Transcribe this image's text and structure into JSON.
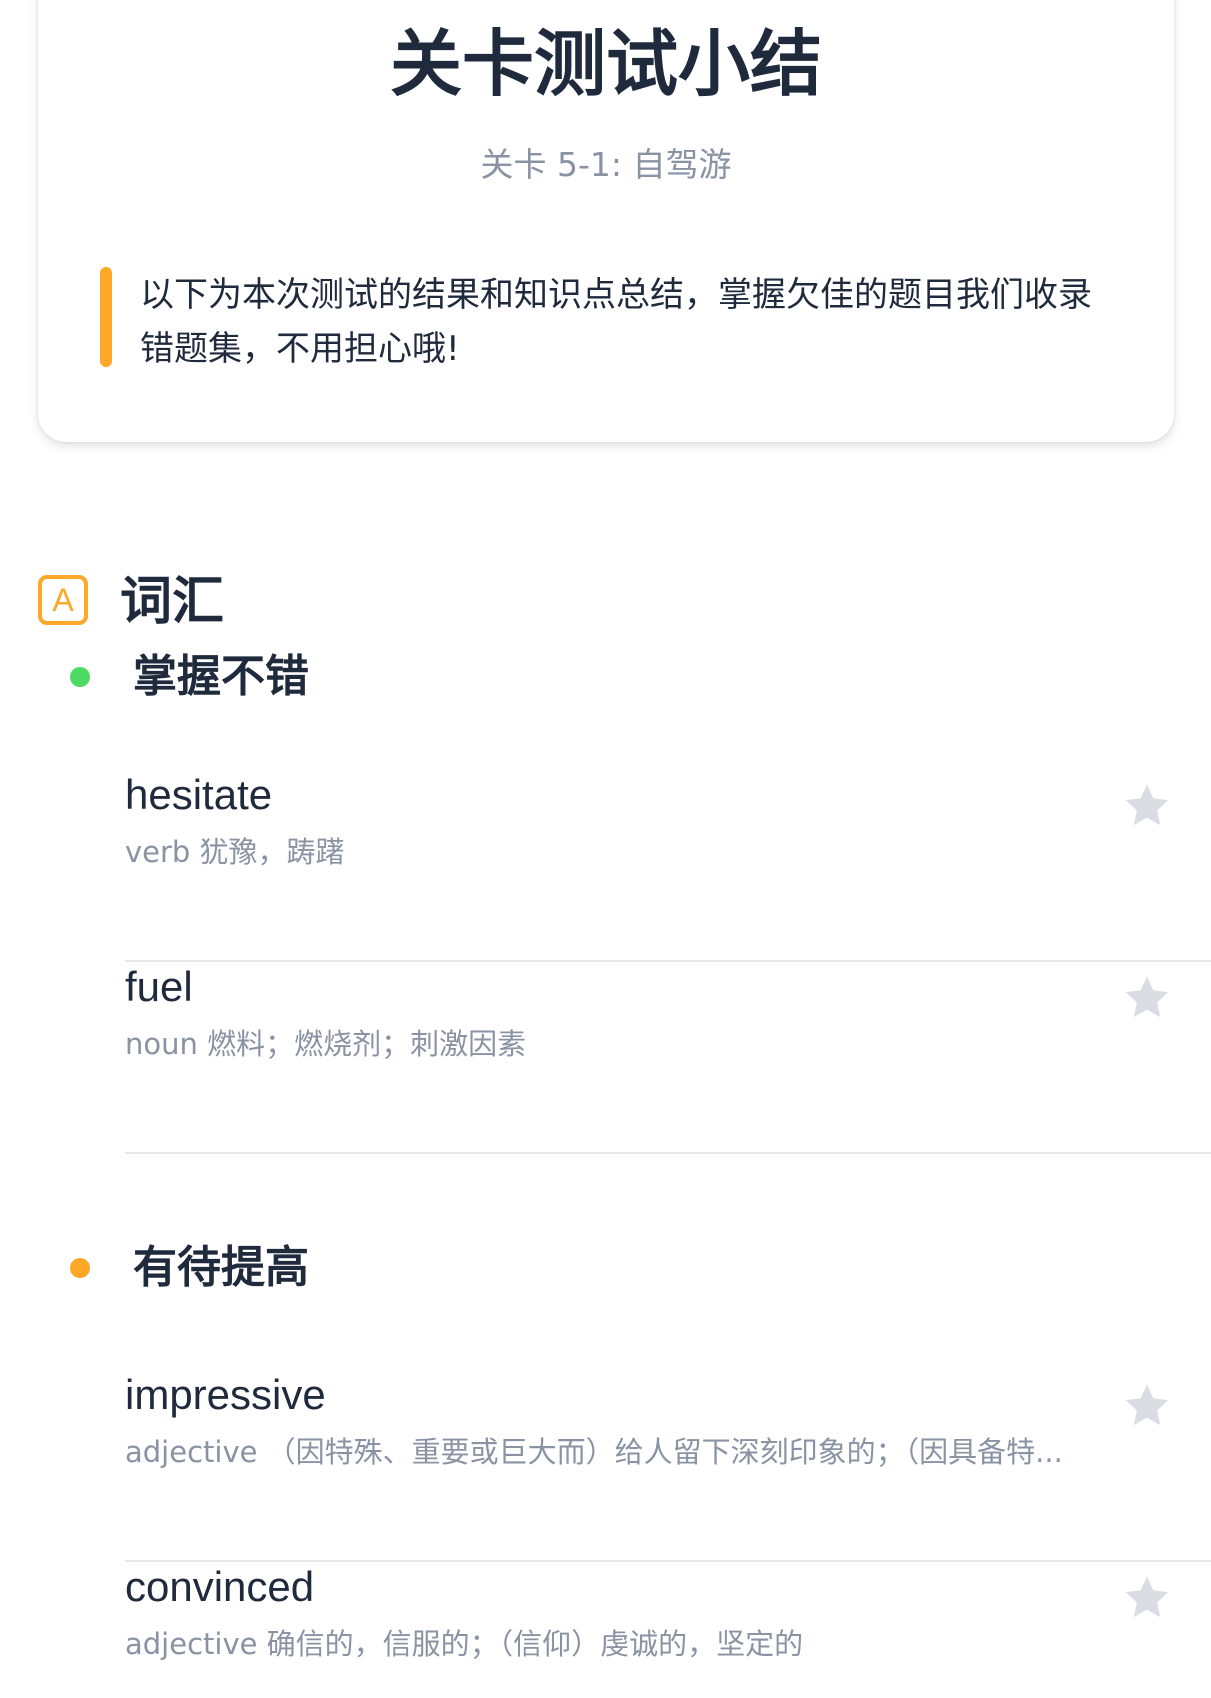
{
  "summary": {
    "title": "关卡测试小结",
    "subtitle": "关卡 5-1: 自驾游",
    "note": "以下为本次测试的结果和知识点总结，掌握欠佳的题目我们收录错题集，不用担心哦!"
  },
  "section": {
    "icon_letter": "A",
    "title": "词汇"
  },
  "groups": [
    {
      "title": "掌握不错",
      "dot_color": "#4cd964",
      "words": [
        {
          "word": "hesitate",
          "meaning": "verb 犹豫，踌躇"
        },
        {
          "word": "fuel",
          "meaning": "noun 燃料；燃烧剂；刺激因素"
        }
      ]
    },
    {
      "title": "有待提高",
      "dot_color": "#ffa726",
      "words": [
        {
          "word": "impressive",
          "meaning": "adjective （因特殊、重要或巨大而）给人留下深刻印象的；（因具备特..."
        },
        {
          "word": "convinced",
          "meaning": "adjective 确信的，信服的；（信仰）虔诚的，坚定的"
        }
      ]
    }
  ],
  "colors": {
    "accent": "#ffa726",
    "good": "#4cd964",
    "text_primary": "#1f2a3c",
    "text_secondary": "#8a93a3",
    "star": "#d9dde3"
  },
  "icons": {
    "section": "letter-a-icon",
    "favorite": "star-icon"
  }
}
